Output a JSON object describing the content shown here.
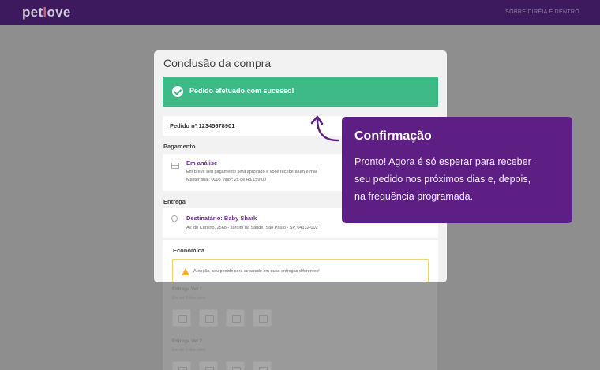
{
  "topbar": {
    "logo": "petlove",
    "link": "SOBRE DIRÉIA E DENTRO"
  },
  "card": {
    "title": "Conclusão da compra",
    "success_message": "Pedido efetuado com sucesso!",
    "order_number": "Pedido nº 12345678901",
    "payment": {
      "section_label": "Pagamento",
      "status": "Em análise",
      "description": "Em breve seu pagamento será aprovado e você receberá um e-mail",
      "details": "Master final: 0098 Valor: 2x de R$ 159,00"
    },
    "delivery": {
      "section_label": "Entrega",
      "recipient": "Destinatário: Baby Shark",
      "address": "Av. do Cursino, 2568 - Jardim da Saúde, São Paulo - SP, 04132-002",
      "shipping_type": "Econômica",
      "warning": "Atenção, seu pedido será separado em duas entregas diferentes!"
    }
  },
  "background": {
    "delivery_1": {
      "label": "Entrega Vet 1",
      "sub": "Em até 5 dias úteis"
    },
    "delivery_2": {
      "label": "Entrega Vet 2",
      "sub": "Em até 5 dias úteis"
    }
  },
  "tooltip": {
    "title": "Confirmação",
    "line1": "Pronto! Agora é só esperar para receber",
    "line2": "seu pedido nos próximos dias e, depois,",
    "line3": "na frequência programada."
  },
  "colors": {
    "brand_purple": "#5d1f84",
    "success_green": "#3dba85",
    "warning_yellow": "#f0b429"
  },
  "icons": [
    "check-circle-icon",
    "credit-card-icon",
    "location-pin-icon",
    "warning-icon",
    "curved-arrow-icon"
  ]
}
